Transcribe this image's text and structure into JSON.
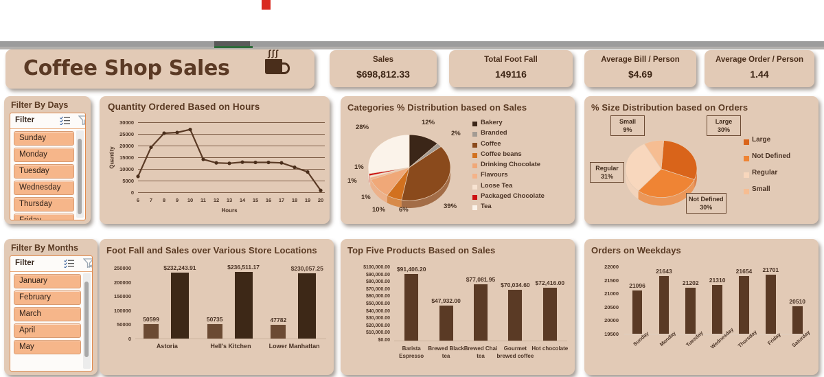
{
  "header": {
    "title": "Coffee Shop Sales",
    "logo_icon": "coffee-mug-icon"
  },
  "kpis": [
    {
      "label": "Sales",
      "value": "$698,812.33"
    },
    {
      "label": "Total Foot Fall",
      "value": "149116"
    },
    {
      "label": "Average Bill / Person",
      "value": "$4.69"
    },
    {
      "label": "Average Order / Person",
      "value": "1.44"
    }
  ],
  "slicers": [
    {
      "title": "Filter By Days",
      "filter_label": "Filter",
      "multiselect_icon": "multi-select-icon",
      "clear_filter_icon": "clear-filter-icon",
      "items": [
        "Sunday",
        "Monday",
        "Tuesday",
        "Wednesday",
        "Thursday",
        "Friday"
      ]
    },
    {
      "title": "Filter By Months",
      "filter_label": "Filter",
      "multiselect_icon": "multi-select-icon",
      "clear_filter_icon": "clear-filter-icon",
      "items": [
        "January",
        "February",
        "March",
        "April",
        "May"
      ]
    }
  ],
  "chart_data": [
    {
      "id": "quantity-by-hours",
      "type": "line",
      "title": "Quantity Ordered Based on Hours",
      "xlabel": "Hours",
      "ylabel": "Quantity",
      "categories": [
        "6",
        "7",
        "8",
        "9",
        "10",
        "11",
        "12",
        "13",
        "14",
        "15",
        "16",
        "17",
        "18",
        "19",
        "20"
      ],
      "values": [
        6800,
        19300,
        25300,
        25600,
        26900,
        14100,
        12600,
        12400,
        12900,
        12800,
        12800,
        12600,
        10700,
        8700,
        800
      ],
      "ylim": [
        0,
        30000
      ],
      "yticks": [
        "0",
        "5000",
        "10000",
        "15000",
        "20000",
        "25000",
        "30000"
      ],
      "grid": true
    },
    {
      "id": "categories-distribution",
      "type": "pie",
      "title": "Categories % Distribution based on Sales",
      "legend_position": "right",
      "labels": [
        "Bakery",
        "Branded",
        "Coffee",
        "Coffee beans",
        "Drinking Chocolate",
        "Flavours",
        "Loose Tea",
        "Packaged Chocolate",
        "Tea"
      ],
      "values": [
        12,
        2,
        39,
        6,
        10,
        1,
        1,
        1,
        28
      ],
      "value_labels": [
        "12%",
        "2%",
        "39%",
        "6%",
        "10%",
        "1%",
        "1%",
        "1%",
        "28%"
      ],
      "colors": [
        "#3b2618",
        "#a39b93",
        "#8a4a1c",
        "#d2711f",
        "#f0a878",
        "#f4b389",
        "#f7e3d2",
        "#cc1111",
        "#fbf3ea"
      ]
    },
    {
      "id": "size-distribution",
      "type": "pie",
      "title": "% Size Distribution based on Orders",
      "legend_position": "right",
      "labels": [
        "Large",
        "Not Defined",
        "Regular",
        "Small"
      ],
      "values": [
        30,
        30,
        31,
        9
      ],
      "value_labels": [
        "30%",
        "30%",
        "31%",
        "9%"
      ],
      "colors": [
        "#d9641a",
        "#ef8434",
        "#f8d7bd",
        "#f6bd92"
      ]
    },
    {
      "id": "footfall-sales-locations",
      "type": "bar",
      "title": "Foot Fall and Sales over Various Store Locations",
      "categories": [
        "Astoria",
        "Hell's Kitchen",
        "Lower Manhattan"
      ],
      "ylim": [
        0,
        250000
      ],
      "yticks": [
        "0",
        "50000",
        "100000",
        "150000",
        "200000",
        "250000"
      ],
      "series": [
        {
          "name": "Foot Fall",
          "values": [
            50599,
            50735,
            47782
          ],
          "labels": [
            "50599",
            "50735",
            "47782"
          ],
          "color": "#6b4a33"
        },
        {
          "name": "Sales",
          "values": [
            232243.91,
            236511.17,
            230057.25
          ],
          "labels": [
            "$232,243.91",
            "$236,511.17",
            "$230,057.25"
          ],
          "color": "#3d2817"
        }
      ]
    },
    {
      "id": "top-five-products",
      "type": "bar",
      "title": "Top Five Products Based on Sales",
      "categories": [
        "Barista Espresso",
        "Brewed Black tea",
        "Brewed Chai tea",
        "Gourmet brewed coffee",
        "Hot chocolate"
      ],
      "values": [
        91406.2,
        47932.0,
        77081.95,
        70034.6,
        72416.0
      ],
      "value_labels": [
        "$91,406.20",
        "$47,932.00",
        "$77,081.95",
        "$70,034.60",
        "$72,416.00"
      ],
      "ylim": [
        0,
        100000
      ],
      "yticks": [
        "$100,000.00",
        "$90,000.00",
        "$80,000.00",
        "$70,000.00",
        "$60,000.00",
        "$50,000.00",
        "$40,000.00",
        "$30,000.00",
        "$20,000.00",
        "$10,000.00",
        "$0.00"
      ],
      "color": "#5a3a25"
    },
    {
      "id": "orders-on-weekdays",
      "type": "bar",
      "title": "Orders on Weekdays",
      "categories": [
        "Sunday",
        "Monday",
        "Tuesday",
        "Wednesday",
        "Thursday",
        "Friday",
        "Saturday"
      ],
      "values": [
        21096,
        21643,
        21202,
        21310,
        21654,
        21701,
        20510
      ],
      "value_labels": [
        "21096",
        "21643",
        "21202",
        "21310",
        "21654",
        "21701",
        "20510"
      ],
      "ylim": [
        19500,
        22000
      ],
      "yticks": [
        "22000",
        "21500",
        "21000",
        "20500",
        "20000",
        "19500"
      ],
      "color": "#5a3a25"
    }
  ]
}
